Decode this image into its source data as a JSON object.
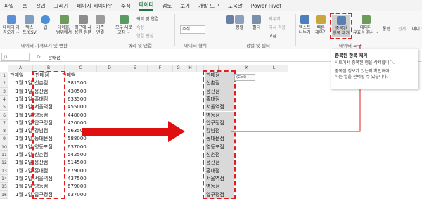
{
  "tabs": [
    "파일",
    "홈",
    "삽입",
    "그리기",
    "페이지 레이아웃",
    "수식",
    "데이터",
    "검토",
    "보기",
    "개발 도구",
    "도움말",
    "Power Pivot"
  ],
  "active_tab": "데이터",
  "ribbon": {
    "get_data": "데이터 가\n져오기 ~",
    "text_csv": "텍스\n트/CSV",
    "web": "웹",
    "table_range": "테이블/\n범위에서",
    "recent_source": "최근에 사\n용한 원본",
    "existing_conn": "기존\n연결",
    "refresh_all": "모두 새로\n고침 ~",
    "queries_conn": "쿼리 및 연결",
    "properties": "속성",
    "edit_links": "연결 편집",
    "data_type_value": "주식",
    "sort_small": "정렬",
    "sort_big": "정렬",
    "filter": "필터",
    "clear": "지우기",
    "reapply": "다시 적용",
    "advanced": "고급",
    "text_split": "텍스트\n나누기",
    "flash_fill": "빠른\n채우기",
    "remove_dup": "중복된\n항목 제거",
    "validation": "데이터\n유효성 검사 ~",
    "consolidate": "통합",
    "relations": "관계",
    "model": "데이\n모델",
    "groups": {
      "get_transform": "데이터 가져오기 및 변환",
      "queries": "쿼리 및 연결",
      "data_types": "데이터 형식",
      "sort_filter": "정렬 및 필터",
      "data_tools": "데이터 도구"
    }
  },
  "tooltip": {
    "title": "중복된 항목 제거",
    "line1": "시트에서 중복된 행을 삭제합니다.",
    "line2": "중복된 정보가 있는지 확인해야",
    "line3": "하는 열을 선택할 수 있습니다."
  },
  "formula_bar": {
    "name_box": "J1",
    "fx": "fx",
    "value": "판매점"
  },
  "columns": [
    "A",
    "B",
    "C",
    "D",
    "E",
    "F",
    "G",
    "H",
    "I",
    "J",
    "K",
    "L"
  ],
  "rows": [
    "1",
    "2",
    "3",
    "4",
    "5",
    "6",
    "7",
    "8",
    "9",
    "10",
    "11",
    "12",
    "13",
    "14",
    "15",
    "16"
  ],
  "table": {
    "headers": [
      "판매일",
      "판매점",
      "판매액"
    ],
    "rows": [
      [
        "1월 1일",
        "신촌점",
        "381500"
      ],
      [
        "1월 1일",
        "용산점",
        "430500"
      ],
      [
        "1월 1일",
        "홍대점",
        "633500"
      ],
      [
        "1월 1일",
        "서울역점",
        "455000"
      ],
      [
        "1월 1일",
        "영등점",
        "448000"
      ],
      [
        "1월 1일",
        "압구정점",
        "420000"
      ],
      [
        "1월 1일",
        "강남점",
        "563500"
      ],
      [
        "1월 1일",
        "동대문점",
        "588000"
      ],
      [
        "1월 1일",
        "영등포점",
        "637000"
      ],
      [
        "1월 2일",
        "신촌점",
        "542500"
      ],
      [
        "1월 2일",
        "용산점",
        "514500"
      ],
      [
        "1월 2일",
        "홍대점",
        "679000"
      ],
      [
        "1월 2일",
        "서울역점",
        "437500"
      ],
      [
        "1월 2일",
        "영등점",
        "679000"
      ],
      [
        "1월 2일",
        "압구정점",
        "637000"
      ]
    ]
  },
  "copied_column": [
    "판매점",
    "신촌점",
    "용산점",
    "홍대점",
    "서울역점",
    "영동점",
    "압구정점",
    "강남점",
    "동대문점",
    "영등포점",
    "신촌점",
    "용산점",
    "홍대점",
    "서울역점",
    "영동점",
    "압구정점"
  ],
  "paste_tag": "(Ctrl)",
  "colors": {
    "accent": "#217346",
    "annotation_red": "#e02020",
    "highlight": "#d9d9d9"
  }
}
